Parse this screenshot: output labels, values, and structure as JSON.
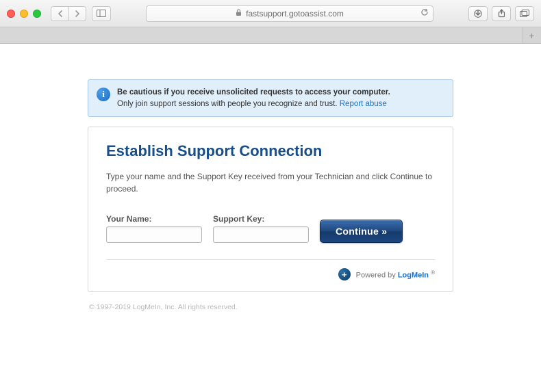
{
  "browser": {
    "url": "fastsupport.gotoassist.com"
  },
  "alert": {
    "bold_line": "Be cautious if you receive unsolicited requests to access your computer.",
    "body_line": "Only join support sessions with people you recognize and trust. ",
    "report_label": "Report abuse"
  },
  "card": {
    "title": "Establish Support Connection",
    "description": "Type your name and the Support Key received from your Technician and click Continue to proceed.",
    "name_label": "Your Name:",
    "key_label": "Support Key:",
    "name_value": "",
    "key_value": "",
    "continue_label": "Continue  »"
  },
  "powered": {
    "prefix": "Powered by ",
    "brand": "LogMeIn",
    "reg": "®"
  },
  "footer": {
    "copyright": "© 1997-2019 LogMeIn, Inc. All rights reserved."
  }
}
